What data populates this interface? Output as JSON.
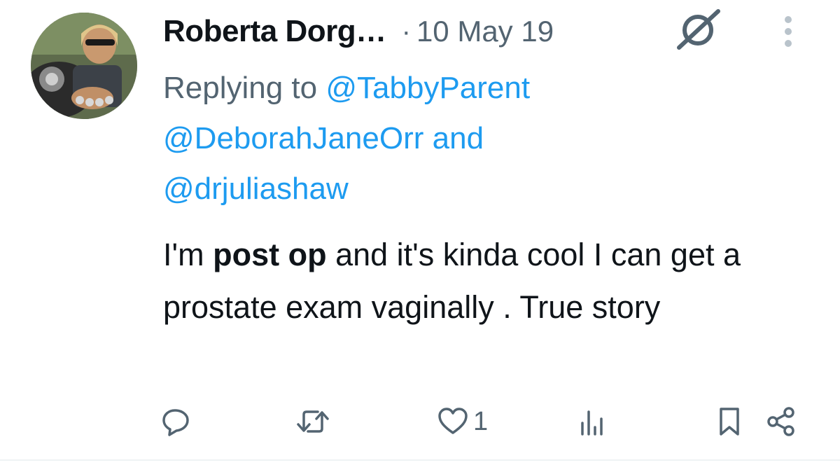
{
  "tweet": {
    "author": {
      "display_name": "Roberta Dorg…",
      "avatar_icon": "profile-photo"
    },
    "separator": "·",
    "timestamp": "10 May 19",
    "reply": {
      "prefix": "Replying to",
      "mentions": [
        "@TabbyParent",
        "@DeborahJaneOrr",
        "@drjuliashaw"
      ],
      "conjunction": "and"
    },
    "text": {
      "before_bold": "I'm ",
      "bold": "post op",
      "after_bold": " and it's kinda cool I can get a prostate exam vaginally . True story"
    },
    "actions": {
      "reply_icon": "speech-bubble-icon",
      "retweet_icon": "retweet-icon",
      "like_icon": "heart-icon",
      "like_count": "1",
      "views_icon": "bar-chart-icon",
      "bookmark_icon": "bookmark-icon",
      "share_icon": "share-icon"
    },
    "header_icons": {
      "badge": "slashed-circle-icon",
      "more": "more-vertical-icon"
    }
  },
  "colors": {
    "text_primary": "#0f1419",
    "text_secondary": "#536471",
    "link": "#1d9bf0",
    "divider": "#eff3f4"
  }
}
